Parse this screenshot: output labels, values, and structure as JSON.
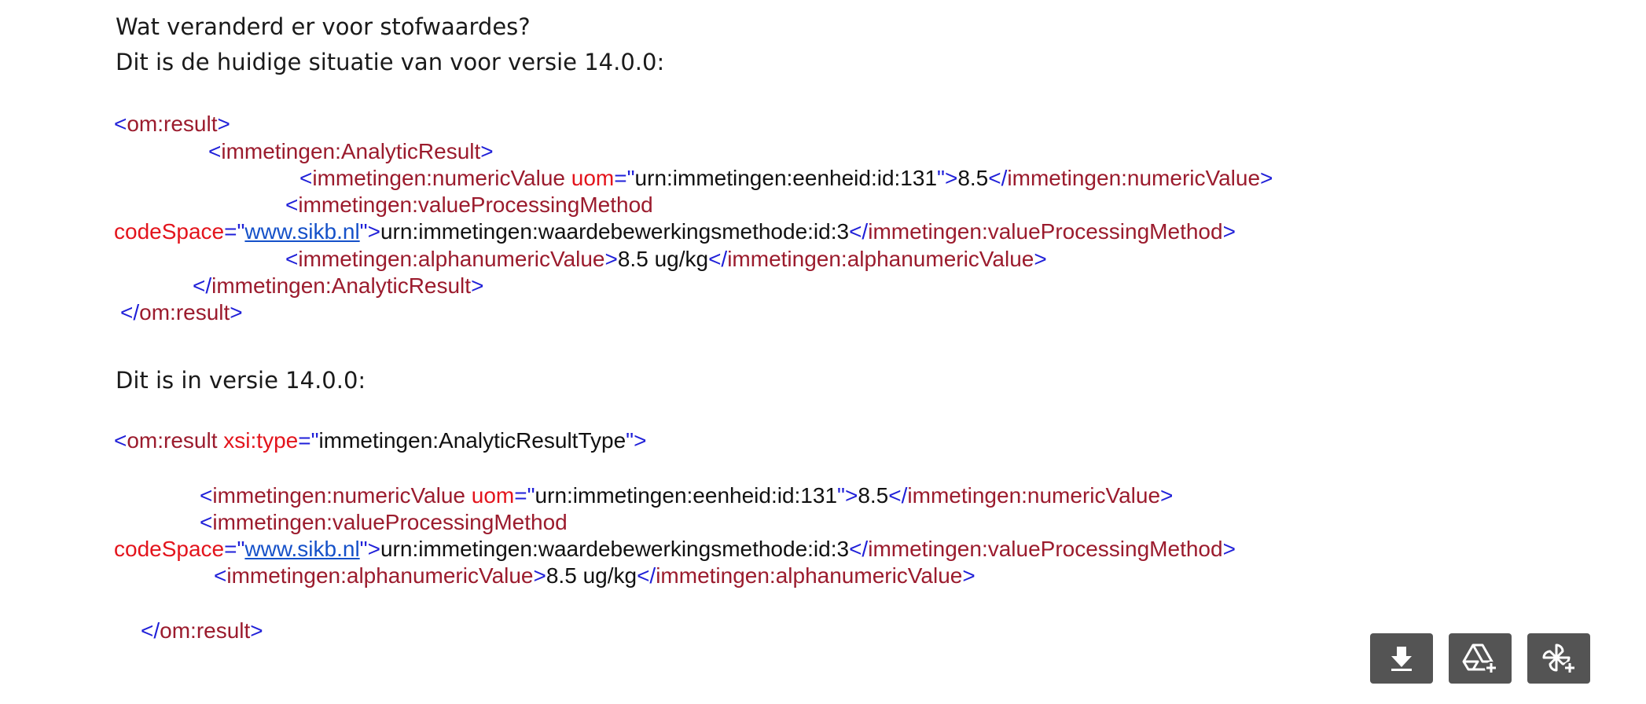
{
  "intro": {
    "question": "Wat veranderd er voor stofwaardes?",
    "before_label": "Dit is de huidige situatie van voor versie 14.0.0:",
    "after_label": "Dit is in versie 14.0.0:"
  },
  "tags": {
    "om_result": "om:result",
    "analytic_result": "immetingen:AnalyticResult",
    "numeric_value": "immetingen:numericValue",
    "processing_method": "immetingen:valueProcessingMethod",
    "alphanumeric_value": "immetingen:alphanumericValue"
  },
  "attrs": {
    "uom": "uom",
    "code_space": "codeSpace",
    "xsi_type": "xsi:type"
  },
  "values": {
    "unit_urn": "urn:immetingen:eenheid:id:131",
    "numeric": "8.5",
    "code_space_link": "www.sikb.nl",
    "method_urn": "urn:immetingen:waardebewerkingsmethode:id:3",
    "alphanumeric": "8.5 ug/kg",
    "result_type": "immetingen:AnalyticResultType"
  },
  "toolbar": {
    "download_icon": "download-icon",
    "drive_icon": "google-drive-add-icon",
    "pinwheel_icon": "pinwheel-add-icon"
  },
  "colors": {
    "bracket": "#1f1fd8",
    "tag": "#9b1b2d",
    "attribute": "#e3141c",
    "value": "#111111",
    "link": "#1551c9",
    "button_bg": "#545454"
  }
}
